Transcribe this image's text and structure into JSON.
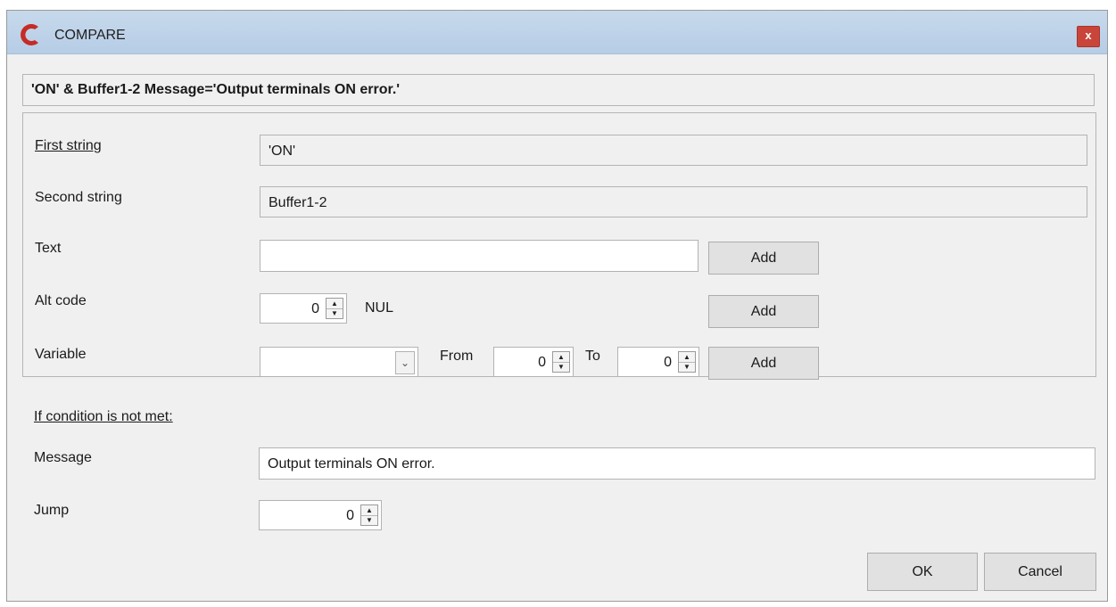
{
  "window": {
    "title": "COMPARE",
    "close_label": "x"
  },
  "summary": "'ON'  &  Buffer1-2   Message='Output terminals ON error.'",
  "first_string": {
    "label": "First string",
    "value": "'ON'"
  },
  "second_string": {
    "label": "Second string",
    "value": "Buffer1-2"
  },
  "text": {
    "label": "Text",
    "value": "",
    "add_label": "Add"
  },
  "alt_code": {
    "label": "Alt code",
    "value": "0",
    "char_name": "NUL",
    "add_label": "Add"
  },
  "variable": {
    "label": "Variable",
    "selected": "",
    "from_label": "From",
    "from_value": "0",
    "to_label": "To",
    "to_value": "0",
    "add_label": "Add"
  },
  "condition": {
    "heading": "If condition is not met:"
  },
  "message": {
    "label": "Message",
    "value": "Output terminals ON error."
  },
  "jump": {
    "label": "Jump",
    "value": "0"
  },
  "buttons": {
    "ok_label": "OK",
    "cancel_label": "Cancel"
  },
  "colors": {
    "titlebar": "#c0d4ea",
    "close": "#c9453a",
    "logo": "#c62b26",
    "dialog_bg": "#f0f0f0"
  },
  "icons": {
    "logo": "c-logo-icon",
    "close": "close-icon",
    "spin_up": "spin-up-icon",
    "spin_down": "spin-down-icon",
    "dropdown": "chevron-down-icon"
  }
}
